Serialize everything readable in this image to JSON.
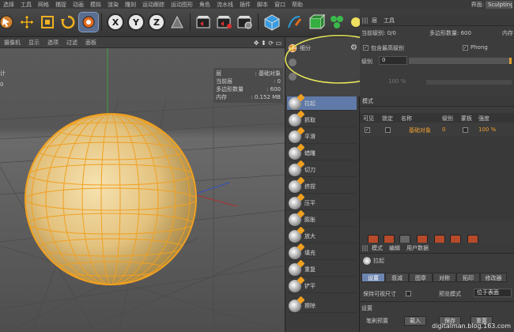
{
  "menu": {
    "items": [
      "选择",
      "工具",
      "网格",
      "捕捉",
      "动画",
      "模拟",
      "渲染",
      "雕刻",
      "运动跟踪",
      "运动图形",
      "角色",
      "流水线",
      "插件",
      "脚本",
      "窗口",
      "帮助"
    ],
    "layout_label": "界面:",
    "layout_value": "Sculpting"
  },
  "toolbar": {
    "axis_x": "X",
    "axis_y": "Y",
    "axis_z": "Z"
  },
  "viewport_menu": {
    "items": [
      "摄像机",
      "显示",
      "选项",
      "过滤",
      "面板"
    ],
    "nav_icons": "✥ ⬍ ⟳ ▭"
  },
  "hud": {
    "left_texts": [
      "计",
      "0"
    ],
    "rows": [
      {
        "label": "层",
        "value": ": 基础对象"
      },
      {
        "label": "当前层",
        "value": ": 0"
      },
      {
        "label": "多边形数量",
        "value": ": 600"
      },
      {
        "label": "内存",
        "value": ": 0.152 MB"
      }
    ]
  },
  "palette": {
    "subdivide_label": "细分",
    "tools": [
      "拉起",
      "抓取",
      "平滑",
      "蜡雕",
      "切刀",
      "挤捏",
      "压平",
      "膨胀",
      "放大",
      "填充",
      "重复",
      "铲平",
      "擦除"
    ],
    "active_tool": "拉起"
  },
  "layers_panel": {
    "tabs": [
      "层",
      "工具"
    ],
    "current_level_label": "当前级别: 0/0",
    "poly_count_label": "多边形数量: 600",
    "memory_label": "内存",
    "include_highest_label": "包含最高级别",
    "phong_label": "Phong",
    "level_label": "级别",
    "level_value": "0",
    "opacity_value": "100 %"
  },
  "mode_panel": {
    "title": "模式",
    "columns": [
      "可见",
      "锁定",
      "名称",
      "级别",
      "蒙板",
      "强度"
    ],
    "row": {
      "name": "基础对象",
      "level": "0",
      "strength": "100 %"
    }
  },
  "attributes": {
    "menu": [
      "模式",
      "编辑",
      "用户数据"
    ],
    "object_label": "拉起",
    "tabs": [
      "设置",
      "衰减",
      "图章",
      "对称",
      "拓印",
      "修改器"
    ],
    "active_tab": "设置",
    "keep_visible_label": "保持可视尺寸",
    "preview_mode_label": "预览模式",
    "preview_mode_value": "位于表面",
    "settings_label": "设置",
    "preset_label": "笔刷预置",
    "load_button": "载入",
    "save_button": "保存",
    "reset_button": "重置"
  },
  "watermark": "digitalman.blog.163.com",
  "colors": {
    "sphere": "#e7c98a",
    "wire": "#f0a020",
    "highlight_circle": "#e8e85a",
    "active_blue": "#5f7aa8"
  }
}
